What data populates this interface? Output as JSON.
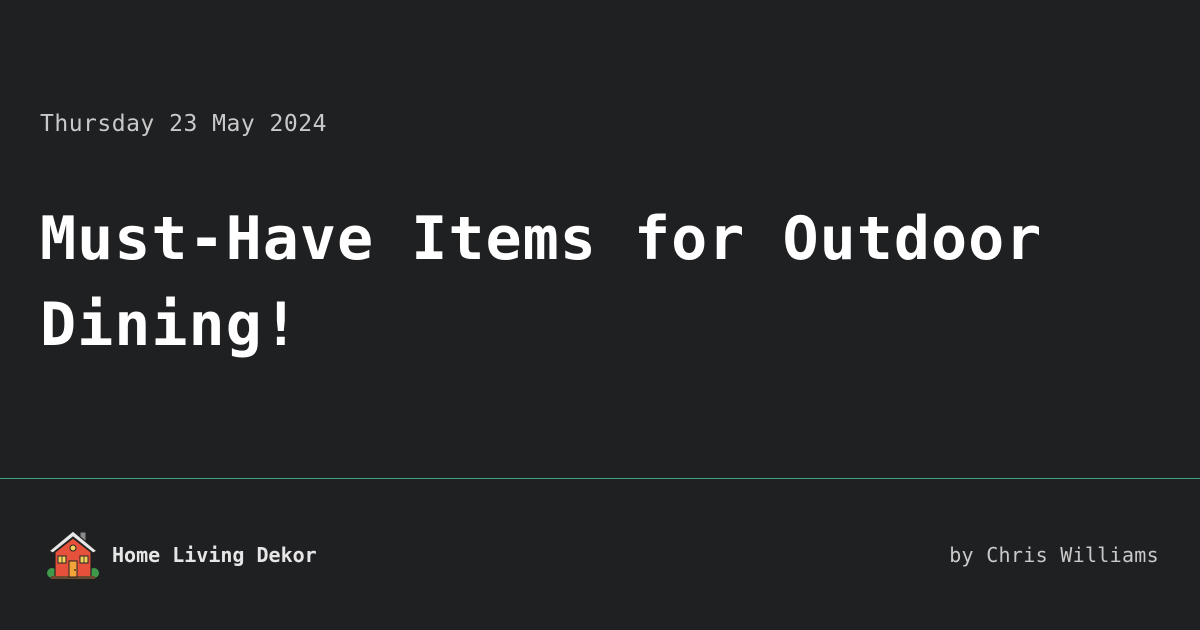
{
  "post": {
    "date": "Thursday 23 May 2024",
    "title": "Must-Have Items for Outdoor Dining!"
  },
  "footer": {
    "logo_icon": "house-icon",
    "brand_name": "Home Living Dekor",
    "byline": "by Chris Williams"
  },
  "colors": {
    "background": "#1f2022",
    "divider": "#3aa27c",
    "title": "#ffffff",
    "muted_text": "#c9c9c9"
  }
}
